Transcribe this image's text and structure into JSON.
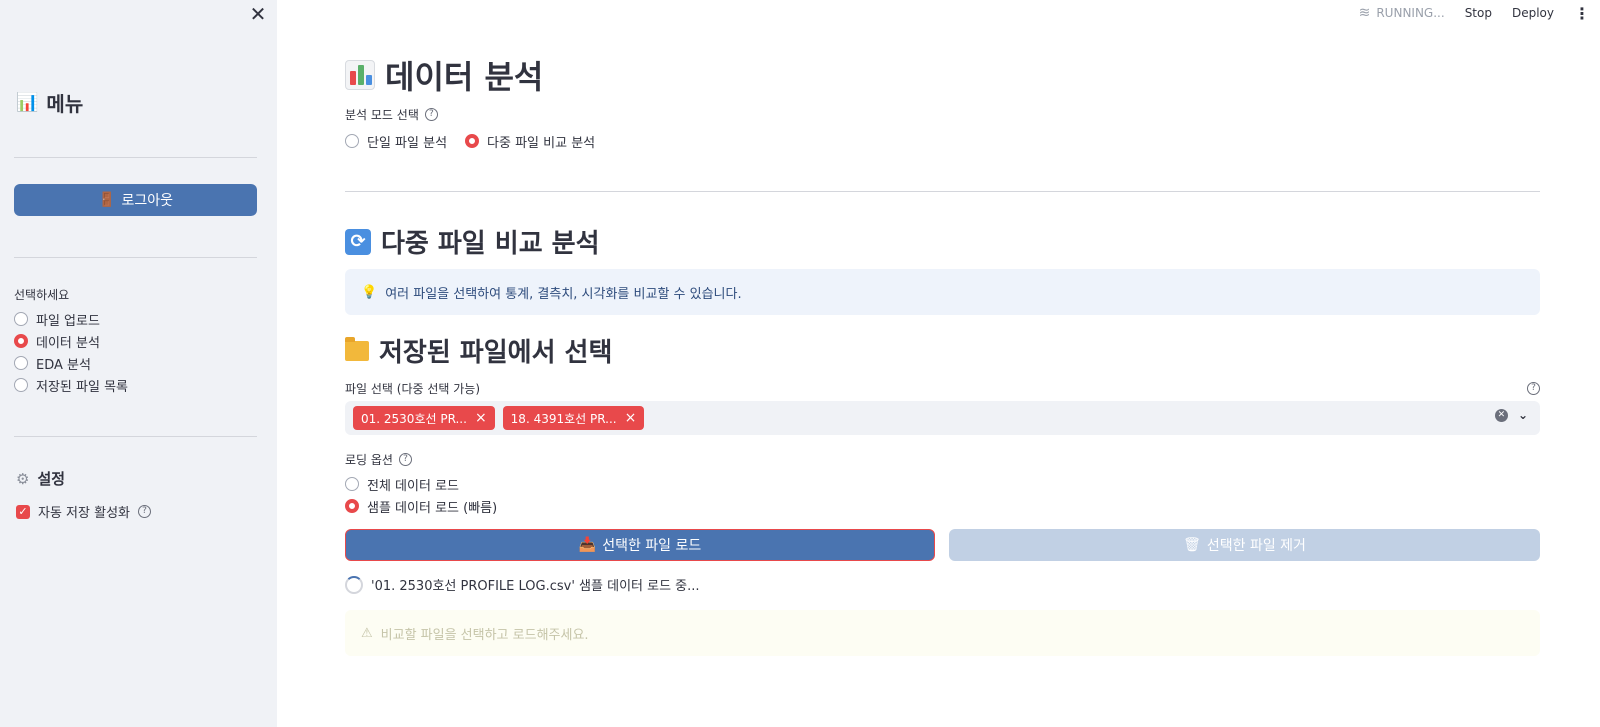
{
  "sidebar": {
    "title": "메뉴",
    "logout_label": "로그아웃",
    "select_label": "선택하세요",
    "nav_items": [
      "파일 업로드",
      "데이터 분석",
      "EDA 분석",
      "저장된 파일 목록"
    ],
    "selected_nav": "데이터 분석",
    "settings_title": "설정",
    "autosave_label": "자동 저장 활성화"
  },
  "topbar": {
    "status": "RUNNING...",
    "stop": "Stop",
    "deploy": "Deploy"
  },
  "main": {
    "title": "데이터 분석",
    "mode_label": "분석 모드 선택",
    "modes": [
      "단일 파일 분석",
      "다중 파일 비교 분석"
    ],
    "selected_mode": "다중 파일 비교 분석",
    "compare_heading": "다중 파일 비교 분석",
    "info_text": "여러 파일을 선택하여 통계, 결측치, 시각화를 비교할 수 있습니다.",
    "saved_heading": "저장된 파일에서 선택",
    "file_select_label": "파일 선택 (다중 선택 가능)",
    "selected_files": [
      "01. 2530호선 PR...",
      "18. 4391호선 PR..."
    ],
    "load_option_label": "로딩 옵션",
    "load_options": [
      "전체 데이터 로드",
      "샘플 데이터 로드 (빠름)"
    ],
    "selected_load_option": "샘플 데이터 로드 (빠름)",
    "load_button": "선택한 파일 로드",
    "remove_button": "선택한 파일 제거",
    "spinner_text": "'01. 2530호선 PROFILE LOG.csv' 샘플 데이터 로드 중...",
    "warning_text": "비교할 파일을 선택하고 로드해주세요."
  },
  "colors": {
    "accent": "#e8494b",
    "primary_button": "#4a74b0",
    "sidebar_bg": "#f0f2f6",
    "info_bg": "#eef3fb"
  }
}
